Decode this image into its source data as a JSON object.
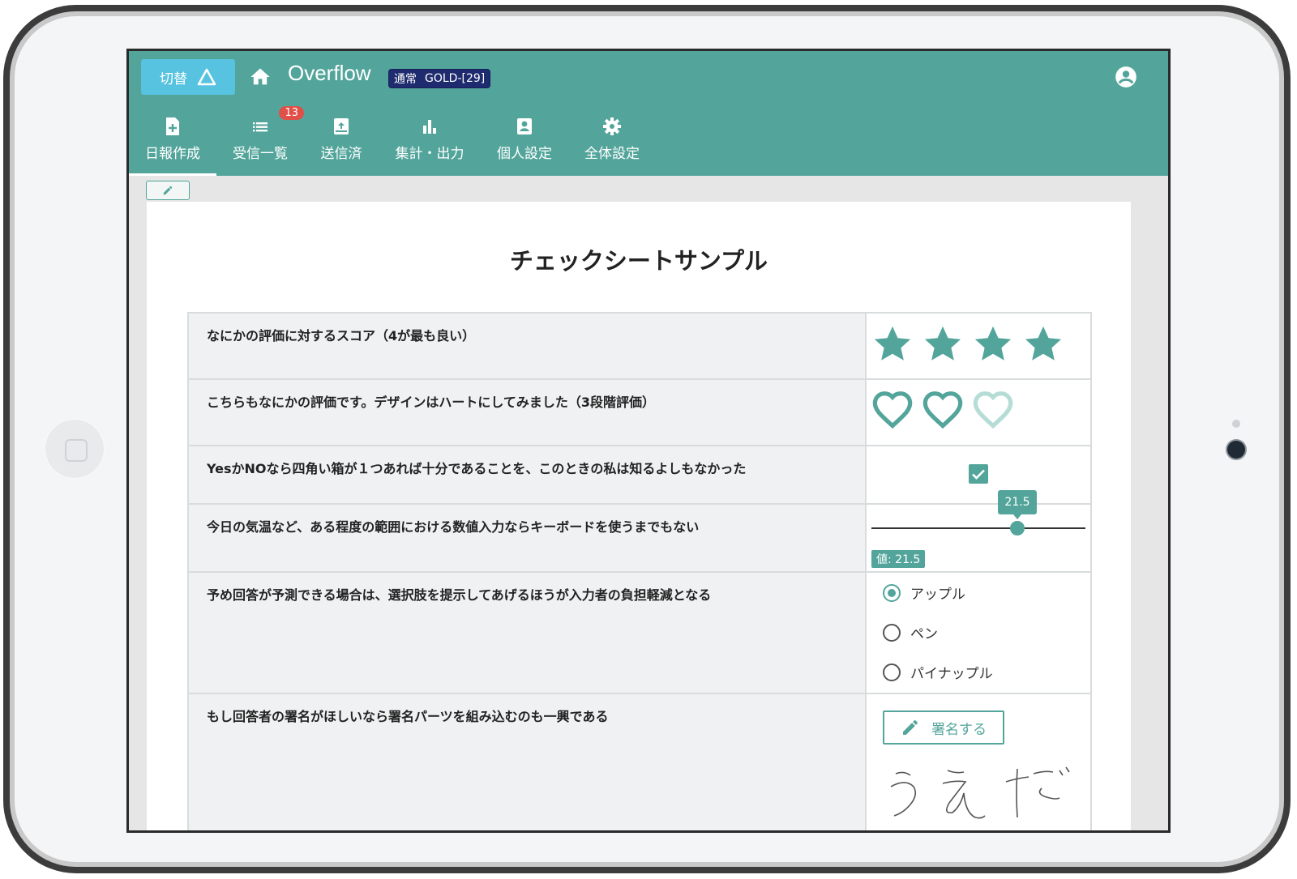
{
  "header": {
    "switch_label": "切替",
    "app_title": "Overflow",
    "badge_mode": "通常",
    "badge_plan": "GOLD-[29]"
  },
  "nav": {
    "items": [
      {
        "label": "日報作成",
        "icon": "new-report-icon",
        "active": true
      },
      {
        "label": "受信一覧",
        "icon": "list-icon",
        "badge": "13"
      },
      {
        "label": "送信済",
        "icon": "outbox-icon"
      },
      {
        "label": "集計・出力",
        "icon": "bar-chart-icon"
      },
      {
        "label": "個人設定",
        "icon": "account-box-icon"
      },
      {
        "label": "全体設定",
        "icon": "gear-icon"
      }
    ]
  },
  "sheet": {
    "title": "チェックシートサンプル",
    "rows": [
      {
        "question": "なにかの評価に対するスコア（4が最も良い）",
        "type": "stars",
        "value": 4,
        "max": 4
      },
      {
        "question": "こちらもなにかの評価です。デザインはハートにしてみました（3段階評価）",
        "type": "hearts",
        "value": 2,
        "max": 3
      },
      {
        "question": "YesかNOなら四角い箱が１つあれば十分であることを、このときの私は知るよしもなかった",
        "type": "checkbox",
        "checked": true
      },
      {
        "question": "今日の気温など、ある程度の範囲における数値入力ならキーボードを使うまでもない",
        "type": "slider",
        "tooltip": "21.5",
        "value_label": "値: 21.5",
        "position_fraction": 0.71
      },
      {
        "question": "予め回答が予測できる場合は、選択肢を提示してあげるほうが入力者の負担軽減となる",
        "type": "radio",
        "options": [
          "アップル",
          "ペン",
          "パイナップル"
        ],
        "selected": "アップル"
      },
      {
        "question": "もし回答者の署名がほしいなら署名パーツを組み込むのも一興である",
        "type": "signature",
        "button_label": "署名する",
        "signature_text": "うえだ"
      }
    ]
  },
  "colors": {
    "primary": "#53a59b",
    "switch_button": "#57c3e0",
    "badge_bg": "#1e2b6e",
    "notification": "#e05048"
  }
}
